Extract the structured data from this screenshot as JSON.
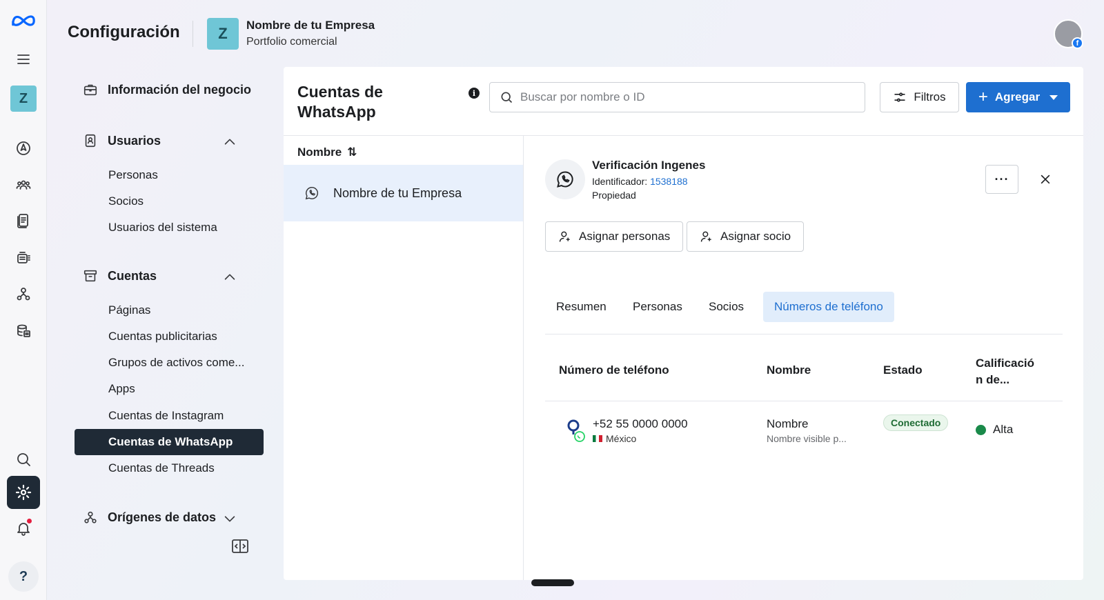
{
  "header": {
    "title": "Configuración",
    "business_initial": "Z",
    "business_name": "Nombre de tu Empresa",
    "business_type": "Portfolio comercial"
  },
  "rail": {
    "tile_initial": "Z",
    "help_label": "?"
  },
  "sidebar": {
    "business_info": "Información del negocio",
    "users_section": "Usuarios",
    "users_items": [
      "Personas",
      "Socios",
      "Usuarios del sistema"
    ],
    "accounts_section": "Cuentas",
    "accounts_items": [
      "Páginas",
      "Cuentas publicitarias",
      "Grupos de activos come...",
      "Apps",
      "Cuentas de Instagram",
      "Cuentas de WhatsApp",
      "Cuentas de Threads"
    ],
    "data_sources_section": "Orígenes de datos",
    "active_item": "Cuentas de WhatsApp"
  },
  "panel": {
    "title": "Cuentas de WhatsApp",
    "info_glyph": "i",
    "search_placeholder": "Buscar por nombre o ID",
    "filters_label": "Filtros",
    "add_label": "Agregar",
    "add_glyph": "+"
  },
  "list": {
    "column_header": "Nombre",
    "sort_glyph": "⇅",
    "rows": [
      {
        "name": "Nombre de tu Empresa"
      }
    ]
  },
  "detail": {
    "name": "Verificación Ingenes",
    "id_label": "Identificador:",
    "id_value": "1538188",
    "ownership": "Propiedad",
    "more_glyph": "···",
    "assign_people": "Asignar personas",
    "assign_partner": "Asignar socio",
    "tabs": [
      "Resumen",
      "Personas",
      "Socios",
      "Números de teléfono"
    ],
    "active_tab": "Números de teléfono",
    "table": {
      "headers": [
        "Número de teléfono",
        "Nombre",
        "Estado",
        "Calificació n de..."
      ],
      "rows": [
        {
          "phone": "+52 55 0000 0000",
          "country": "México",
          "name": "Nombre",
          "display_name": "Nombre visible p...",
          "status": "Conectado",
          "rating": "Alta"
        }
      ]
    }
  },
  "colors": {
    "accent": "#1e6fd0",
    "active_nav": "#1f2a36",
    "tile": "#6fc6d6",
    "rating_green": "#1a8a4a"
  }
}
